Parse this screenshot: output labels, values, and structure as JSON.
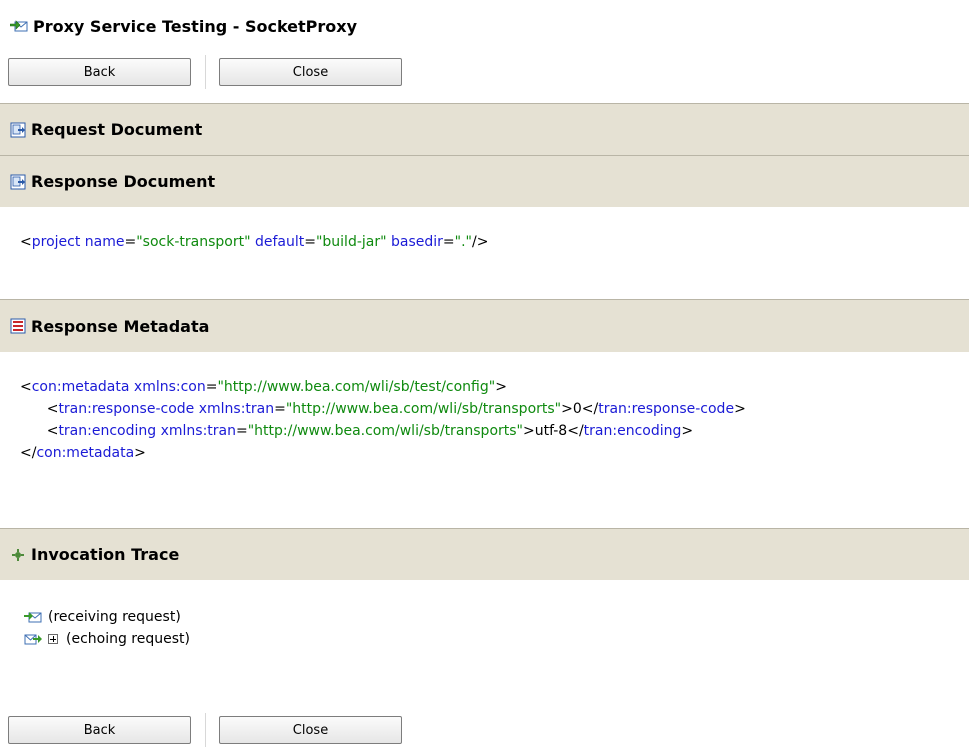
{
  "page": {
    "title": "Proxy Service Testing - SocketProxy"
  },
  "buttons": {
    "back": "Back",
    "close": "Close"
  },
  "sections": {
    "request": "Request Document",
    "response": "Response Document",
    "metadata": "Response Metadata",
    "trace": "Invocation Trace"
  },
  "response_document": {
    "open": "<",
    "tag": "project",
    "attr1_name": "name",
    "attr1_value": "\"sock-transport\"",
    "attr2_name": "default",
    "attr2_value": "\"build-jar\"",
    "attr3_name": "basedir",
    "attr3_value": "\".\"",
    "close": "/>"
  },
  "response_metadata": {
    "line1": {
      "tag": "con:metadata",
      "attr": "xmlns:con",
      "value": "\"http://www.bea.com/wli/sb/test/config\""
    },
    "line2": {
      "tag": "tran:response-code",
      "attr": "xmlns:tran",
      "value": "\"http://www.bea.com/wli/sb/transports\"",
      "text": "0",
      "end_tag": "tran:response-code"
    },
    "line3": {
      "tag": "tran:encoding",
      "attr": "xmlns:tran",
      "value": "\"http://www.bea.com/wli/sb/transports\"",
      "text": "utf-8",
      "end_tag": "tran:encoding"
    },
    "line4": {
      "end_tag": "con:metadata"
    }
  },
  "invocation_trace": {
    "items": [
      "(receiving request)",
      "(echoing request)"
    ]
  },
  "colors": {
    "section_bg": "#e5e1d3",
    "xml_tag": "#1b1bd6",
    "xml_value": "#0f8a0f"
  }
}
